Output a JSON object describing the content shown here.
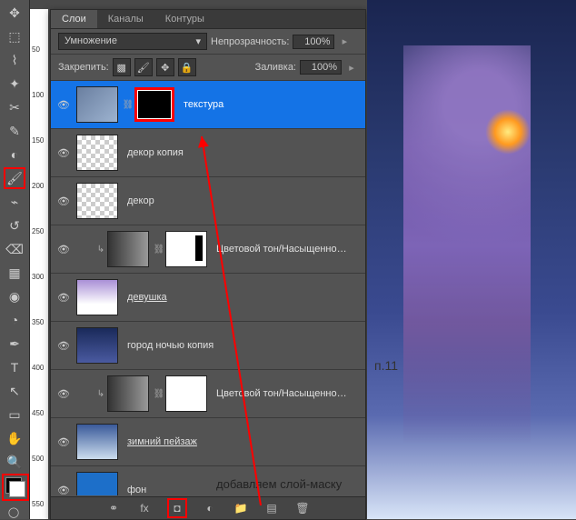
{
  "tabs": {
    "layers": "Слои",
    "channels": "Каналы",
    "paths": "Контуры"
  },
  "controls": {
    "blend_mode": "Умножение",
    "opacity_label": "Непрозрачность:",
    "opacity_value": "100%",
    "lock_label": "Закрепить:",
    "fill_label": "Заливка:",
    "fill_value": "100%"
  },
  "layers": [
    {
      "name": "текстура",
      "selected": true,
      "has_mask": true
    },
    {
      "name": "декор копия"
    },
    {
      "name": "декор"
    },
    {
      "name": "Цветовой тон/Насыщенно…",
      "adjust": true
    },
    {
      "name": "девушка",
      "underline": true
    },
    {
      "name": "город ночью копия"
    },
    {
      "name": "Цветовой тон/Насыщенно…",
      "adjust": true
    },
    {
      "name": "зимний пейзаж",
      "underline": true
    },
    {
      "name": "фон"
    }
  ],
  "annotations": {
    "mask_text": "добавляем слой-маску",
    "step": "п.11"
  },
  "ruler_marks": [
    "50",
    "100",
    "150",
    "200",
    "250",
    "300",
    "350",
    "400",
    "450",
    "500",
    "550"
  ]
}
